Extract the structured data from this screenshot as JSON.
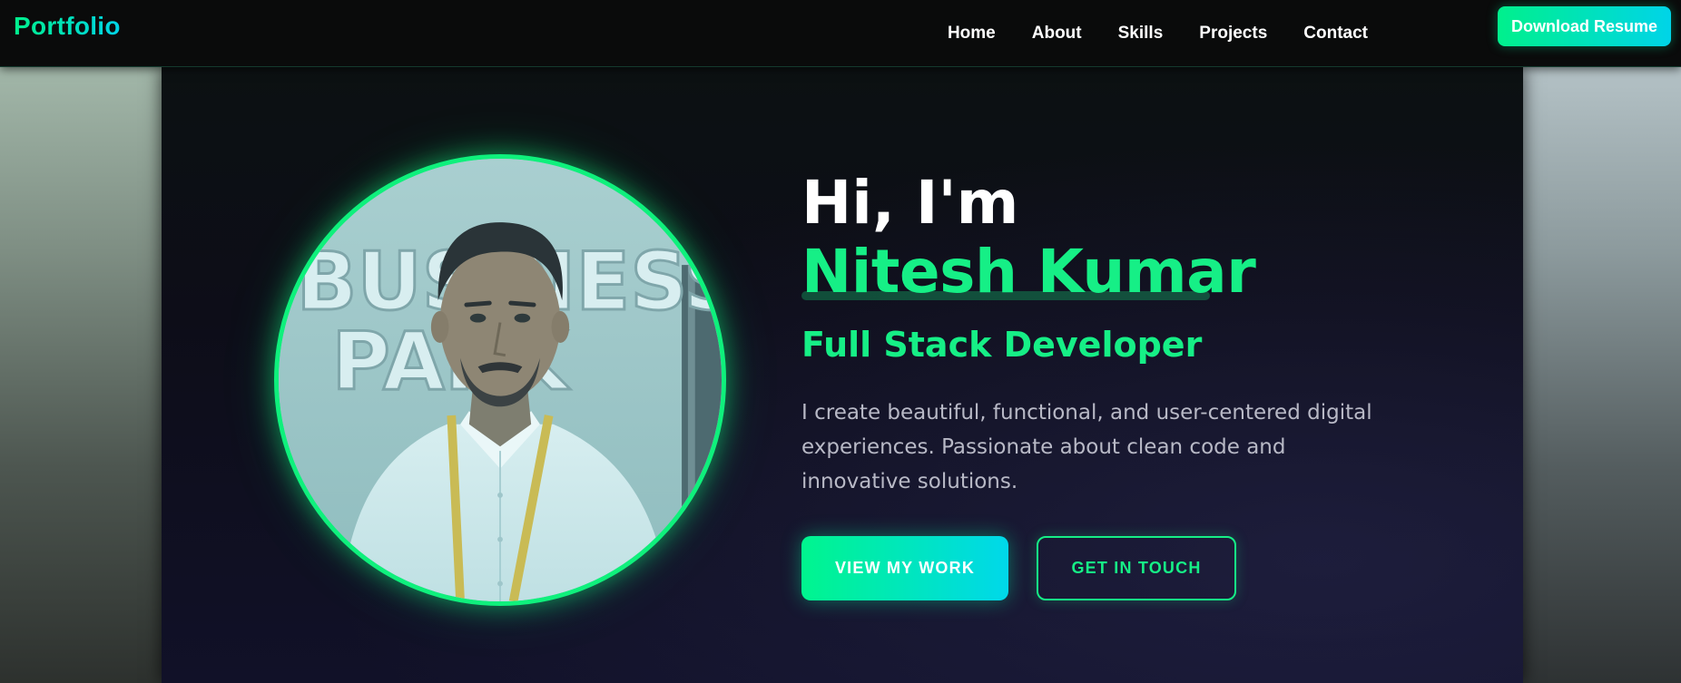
{
  "navbar": {
    "brand": "Portfolio",
    "links": [
      "Home",
      "About",
      "Skills",
      "Projects",
      "Contact"
    ],
    "resume_button": "Download Resume"
  },
  "hero": {
    "greeting": "Hi, I'm",
    "name": "Nitesh Kumar",
    "role": "Full Stack Developer",
    "intro": "I create beautiful, functional, and user-centered digital experiences. Passionate about clean code and innovative solutions.",
    "primary_button": "VIEW MY WORK",
    "secondary_button": "GET IN TOUCH",
    "photo_sign_text": [
      "BUSINESS",
      "PARK"
    ]
  },
  "colors": {
    "accent_green": "#16ef86",
    "accent_cyan": "#00d4e8",
    "navbar_bg": "#0a0b0b",
    "hero_bg": "#0d0d18"
  }
}
